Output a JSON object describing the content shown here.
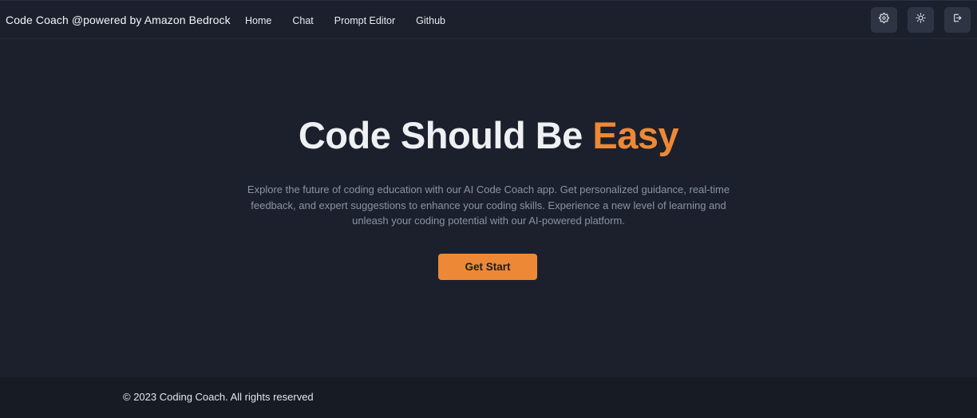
{
  "navbar": {
    "brand": "Code Coach @powered by Amazon Bedrock",
    "links": [
      "Home",
      "Chat",
      "Prompt Editor",
      "Github"
    ],
    "icons": [
      "gear-icon",
      "sun-icon",
      "logout-icon"
    ]
  },
  "hero": {
    "headline_main": "Code Should Be ",
    "headline_accent": "Easy",
    "description": "Explore the future of coding education with our AI Code Coach app. Get personalized guidance, real-time feedback, and expert suggestions to enhance your coding skills. Experience a new level of learning and unleash your coding potential with our AI-powered platform.",
    "cta_label": "Get Start"
  },
  "footer": {
    "copyright": "© 2023 Coding Coach. All rights reserved"
  },
  "colors": {
    "background": "#1b202c",
    "accent": "#ed8936",
    "footer_bg": "#171b24",
    "icon_button_bg": "#2e3443"
  }
}
